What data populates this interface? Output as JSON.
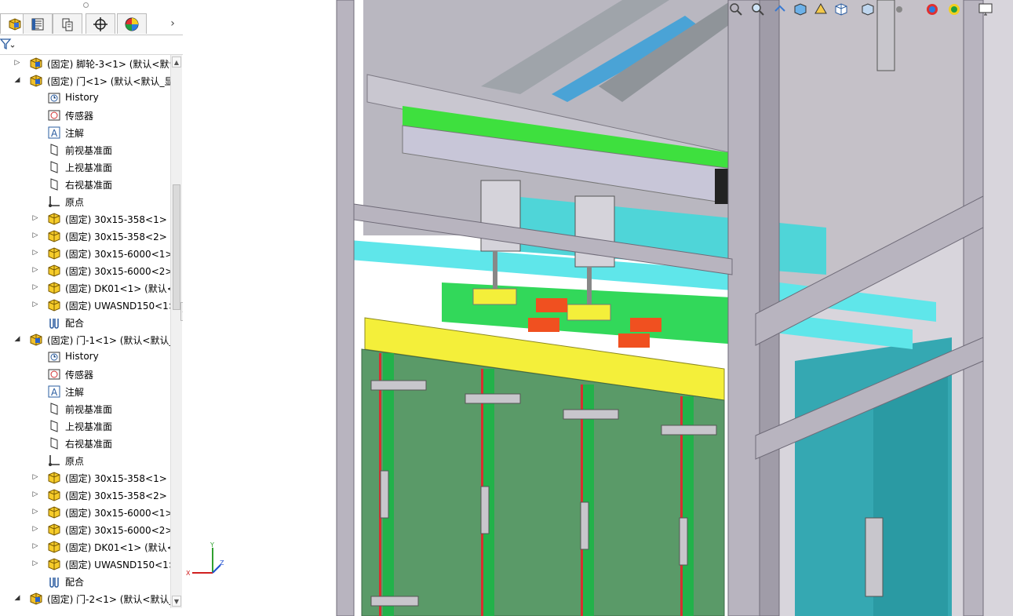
{
  "tree_items": [
    {
      "arrow": "▷",
      "label": "(固定) 脚轮-3<1> (默认<默认"
    },
    {
      "arrow": "◢",
      "label": "(固定) 门<1> (默认<默认_显"
    },
    {
      "arrow": "",
      "label": "History"
    },
    {
      "arrow": "",
      "label": "传感器"
    },
    {
      "arrow": "",
      "label": "注解"
    },
    {
      "arrow": "",
      "label": "前视基准面"
    },
    {
      "arrow": "",
      "label": "上视基准面"
    },
    {
      "arrow": "",
      "label": "右视基准面"
    },
    {
      "arrow": "",
      "label": "原点"
    },
    {
      "arrow": "▷",
      "label": "(固定) 30x15-358<1> (默"
    },
    {
      "arrow": "▷",
      "label": "(固定) 30x15-358<2> (默"
    },
    {
      "arrow": "▷",
      "label": "(固定) 30x15-6000<1>"
    },
    {
      "arrow": "▷",
      "label": "(固定) 30x15-6000<2>"
    },
    {
      "arrow": "▷",
      "label": "(固定) DK01<1> (默认<"
    },
    {
      "arrow": "▷",
      "label": "(固定) UWASND150<1>"
    },
    {
      "arrow": "",
      "label": "配合"
    },
    {
      "arrow": "◢",
      "label": "(固定) 门-1<1> (默认<默认_"
    },
    {
      "arrow": "",
      "label": "History"
    },
    {
      "arrow": "",
      "label": "传感器"
    },
    {
      "arrow": "",
      "label": "注解"
    },
    {
      "arrow": "",
      "label": "前视基准面"
    },
    {
      "arrow": "",
      "label": "上视基准面"
    },
    {
      "arrow": "",
      "label": "右视基准面"
    },
    {
      "arrow": "",
      "label": "原点"
    },
    {
      "arrow": "▷",
      "label": "(固定) 30x15-358<1> (默"
    },
    {
      "arrow": "▷",
      "label": "(固定) 30x15-358<2> (默"
    },
    {
      "arrow": "▷",
      "label": "(固定) 30x15-6000<1>"
    },
    {
      "arrow": "▷",
      "label": "(固定) 30x15-6000<2>"
    },
    {
      "arrow": "▷",
      "label": "(固定) DK01<1> (默认<"
    },
    {
      "arrow": "▷",
      "label": "(固定) UWASND150<1>"
    },
    {
      "arrow": "",
      "label": "配合"
    },
    {
      "arrow": "◢",
      "label": "(固定) 门-2<1> (默认<默认_"
    }
  ],
  "triad": {
    "x": "X",
    "y": "Y",
    "z": "Z"
  },
  "colors": {
    "frame": "#b8b4bf",
    "panel_green": "#5a9a68",
    "yellow": "#f4ef3a",
    "cyan": "#5fe0e6",
    "teal": "#2aa3ab"
  }
}
